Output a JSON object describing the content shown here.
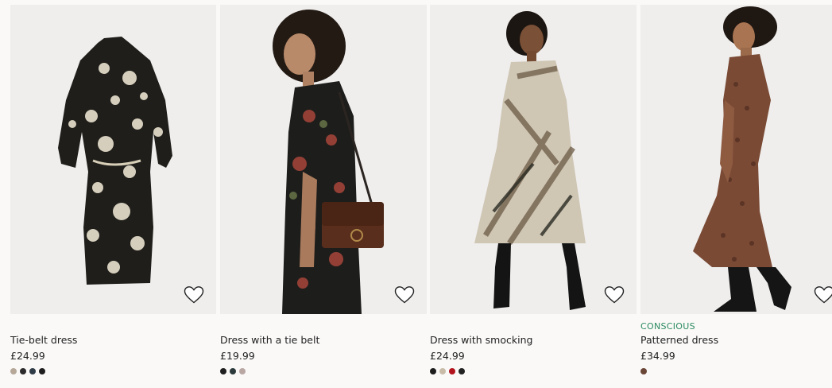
{
  "products": [
    {
      "name": "Tie-belt dress",
      "price": "£24.99",
      "label": "",
      "image_icon": "dress-photo",
      "swatches": [
        "#b6a898",
        "#2b2b2b",
        "#2f3b46",
        "#1e1e1e"
      ]
    },
    {
      "name": "Dress with a tie belt",
      "price": "£19.99",
      "label": "",
      "image_icon": "model-photo",
      "swatches": [
        "#1f1f1f",
        "#2c3a3b",
        "#b9a7a4"
      ]
    },
    {
      "name": "Dress with smocking",
      "price": "£24.99",
      "label": "",
      "image_icon": "model-photo",
      "swatches": [
        "#1d1d1d",
        "#c8bca9",
        "#b3131c",
        "#222222"
      ]
    },
    {
      "name": "Patterned dress",
      "price": "£34.99",
      "label": "CONSCIOUS",
      "image_icon": "model-photo",
      "swatches": [
        "#6a4636"
      ]
    }
  ],
  "favourite_icon": "heart-outline-icon",
  "colors": {
    "conscious": "#2a8a5e",
    "background": "#faf9f8",
    "image_bg": "#efeeed"
  }
}
